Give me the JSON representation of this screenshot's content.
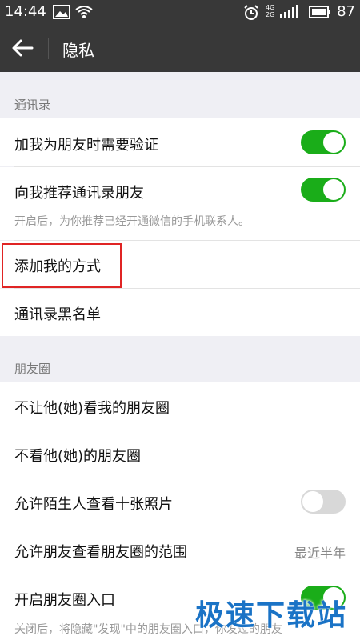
{
  "status_bar": {
    "time": "14:44",
    "battery_level": "87",
    "network_label_top": "4G",
    "network_label_bottom": "2G"
  },
  "title_bar": {
    "title": "隐私"
  },
  "sections": {
    "contacts": {
      "header": "通讯录",
      "verify_friend": {
        "label": "加我为朋友时需要验证",
        "enabled": true
      },
      "recommend_contacts": {
        "label": "向我推荐通讯录朋友",
        "hint": "开启后，为你推荐已经开通微信的手机联系人。",
        "enabled": true
      },
      "add_methods": {
        "label": "添加我的方式"
      },
      "blacklist": {
        "label": "通讯录黑名单"
      }
    },
    "moments": {
      "header": "朋友圈",
      "hide_from": {
        "label": "不让他(她)看我的朋友圈"
      },
      "dont_see": {
        "label": "不看他(她)的朋友圈"
      },
      "stranger_photos": {
        "label": "允许陌生人查看十张照片",
        "enabled": false
      },
      "visible_range": {
        "label": "允许朋友查看朋友圈的范围",
        "value": "最近半年"
      },
      "moments_entry": {
        "label": "开启朋友圈入口",
        "hint": "关闭后，将隐藏\"发现\"中的朋友圈入口，你发过的朋友",
        "enabled": true
      }
    }
  },
  "watermark": "极速下载站",
  "colors": {
    "bar_bg": "#383838",
    "toggle_on": "#1aad19",
    "toggle_off": "#d8d8d8",
    "highlight": "#e02424"
  }
}
